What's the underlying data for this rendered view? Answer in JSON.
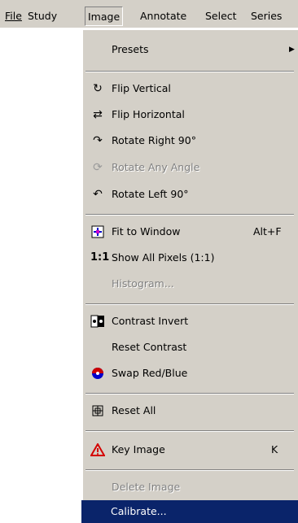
{
  "menubar": {
    "items": [
      "File",
      "Study",
      "Image",
      "Annotate",
      "Select",
      "Series"
    ],
    "active": "Image"
  },
  "menu": {
    "items": [
      {
        "label": "Presets",
        "submenu": true,
        "icon": ""
      },
      {
        "label": "Flip Vertical",
        "icon": "flip-vertical-icon"
      },
      {
        "label": "Flip Horizontal",
        "icon": "flip-horizontal-icon"
      },
      {
        "label": "Rotate Right 90°",
        "icon": "rotate-right-icon"
      },
      {
        "label": "Rotate Any Angle",
        "icon": "rotate-any-angle-icon",
        "disabled": true
      },
      {
        "label": "Rotate Left 90°",
        "icon": "rotate-left-icon"
      },
      {
        "label": "Fit to Window",
        "shortcut": "Alt+F",
        "icon": "fit-to-window-icon"
      },
      {
        "label": "Show All Pixels (1:1)",
        "icon": "one-to-one-icon"
      },
      {
        "label": "Histogram...",
        "disabled": true
      },
      {
        "label": "Contrast Invert",
        "icon": "contrast-invert-icon"
      },
      {
        "label": "Reset Contrast"
      },
      {
        "label": "Swap Red/Blue",
        "icon": "swap-red-blue-icon"
      },
      {
        "label": "Reset All",
        "icon": "reset-all-icon"
      },
      {
        "label": "Key Image",
        "shortcut": "K",
        "icon": "warning-icon"
      },
      {
        "label": "Delete Image",
        "disabled": true
      },
      {
        "label": "Calibrate...",
        "highlighted": true
      }
    ]
  },
  "colors": {
    "menu_bg": "#d4d0c8",
    "highlight": "#0a246a",
    "warning": "#d40000",
    "swap_red": "#cc0000",
    "swap_blue": "#0000cc"
  }
}
